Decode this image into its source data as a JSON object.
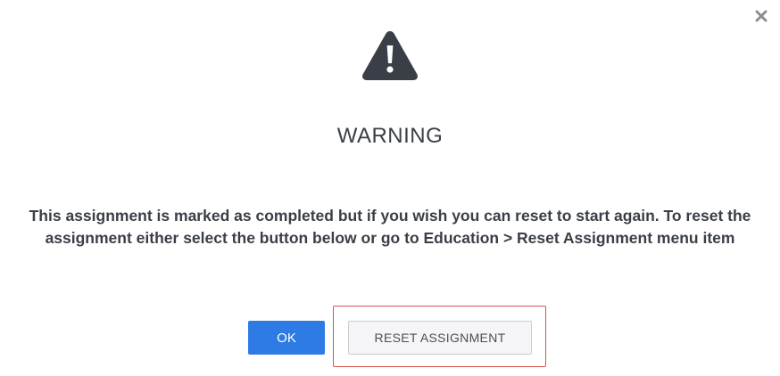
{
  "dialog": {
    "close_icon": "close-icon",
    "warning_icon": "warning-triangle-icon",
    "title": "WARNING",
    "message": "This assignment is marked as completed but if you wish you can reset to start again. To reset the assignment either select the button below or go to Education > Reset Assignment menu item",
    "ok_label": "OK",
    "reset_label": "RESET ASSIGNMENT"
  },
  "colors": {
    "primary": "#2f7be5",
    "text": "#3a3f47",
    "highlight": "#d9534f",
    "icon": "#3a3f47"
  }
}
